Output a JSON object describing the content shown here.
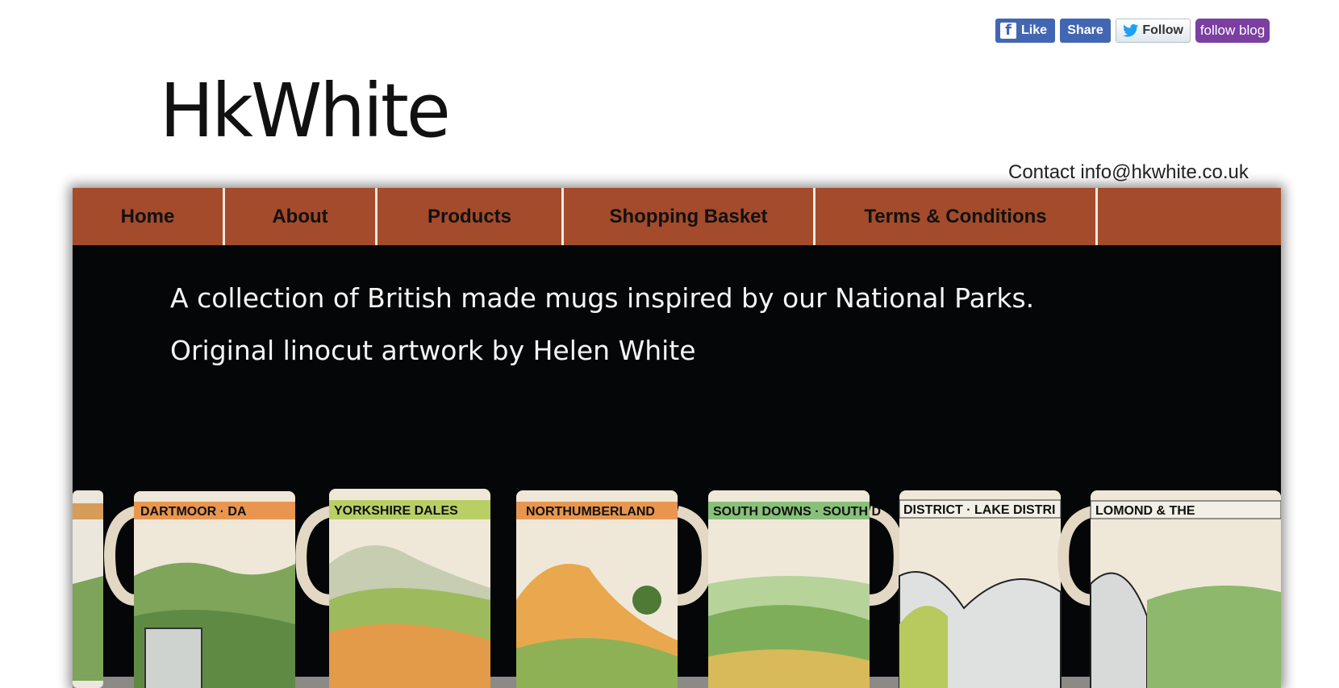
{
  "social": {
    "like_label": "Like",
    "share_label": "Share",
    "follow_label": "Follow",
    "blog_label": "follow blog"
  },
  "logo": {
    "text": "HkWhite"
  },
  "contact": {
    "text": "Contact info@hkwhite.co.uk"
  },
  "nav": {
    "items": [
      {
        "label": "Home"
      },
      {
        "label": "About"
      },
      {
        "label": "Products"
      },
      {
        "label": "Shopping Basket"
      },
      {
        "label": "Terms & Conditions"
      }
    ]
  },
  "hero": {
    "line1": "A collection of British made mugs inspired by our National Parks.",
    "line2": "Original linocut artwork by Helen White",
    "mug_bands": [
      "DARTMOOR · DA",
      "YORKSHIRE DALES",
      "NORTHUMBERLAND",
      "SOUTH DOWNS · SOUTH D",
      "DISTRICT · LAKE DISTRI",
      "LOMOND & THE"
    ]
  },
  "colors": {
    "nav_bg": "#a34b2b",
    "hero_bg": "#050607",
    "facebook": "#4267b2",
    "blog": "#7b3fa2"
  }
}
